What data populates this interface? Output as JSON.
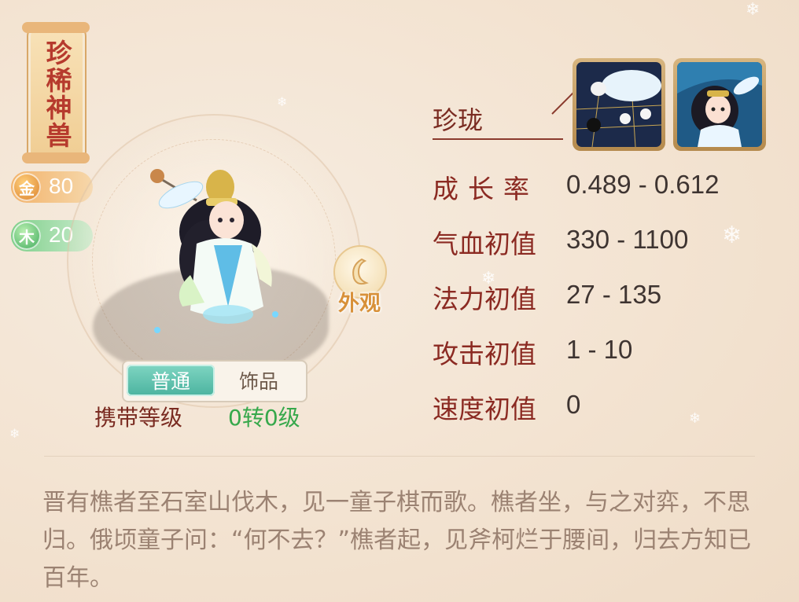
{
  "rarity_tag": "珍稀神兽",
  "elements": [
    {
      "icon": "金",
      "value": "80",
      "color": "#e89a4a"
    },
    {
      "icon": "木",
      "value": "20",
      "color": "#4db96a"
    }
  ],
  "appearance_button": "外观",
  "tabs": {
    "normal": "普通",
    "accessory": "饰品",
    "active": "normal"
  },
  "carry_level": {
    "label": "携带等级",
    "value": "0转0级"
  },
  "pet_name": "珍珑",
  "skills": [
    {
      "icon": "go-board-hand-icon"
    },
    {
      "icon": "pet-portrait-icon"
    }
  ],
  "stats": [
    {
      "label": "成长率",
      "value": "0.489 - 0.612"
    },
    {
      "label": "气血初值",
      "value": "330 - 1100"
    },
    {
      "label": "法力初值",
      "value": "27 - 135"
    },
    {
      "label": "攻击初值",
      "value": "1 - 10"
    },
    {
      "label": "速度初值",
      "value": "0"
    }
  ],
  "description": "晋有樵者至石室山伐木，见一童子棋而歌。樵者坐，与之对弈，不思归。俄顷童子问：“何不去？”樵者起，见斧柯烂于腰间，归去方知已百年。"
}
